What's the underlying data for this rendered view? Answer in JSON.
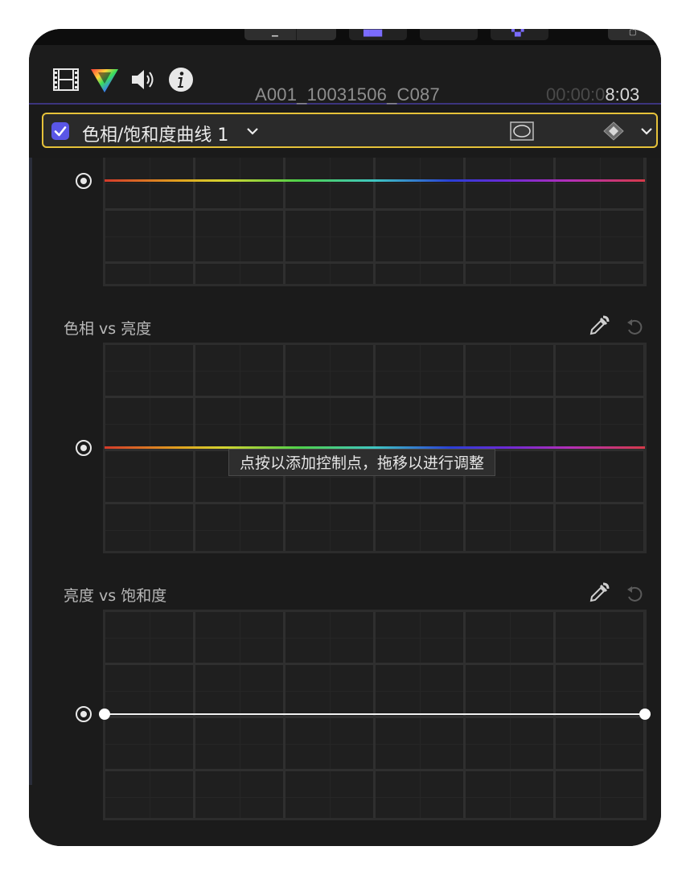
{
  "header": {
    "clip_title": "A001_10031506_C087",
    "timecode_dim": "00:00:0",
    "timecode_bright": "8:03",
    "icons": [
      "film-icon",
      "color-inspector-icon",
      "audio-icon",
      "info-icon"
    ]
  },
  "effect": {
    "enabled": true,
    "name": "色相/饱和度曲线 1",
    "accent_color": "#5a56e6",
    "selection_color": "#e6c23a"
  },
  "sections": [
    {
      "label": ""
    },
    {
      "label": "色相 vs 亮度"
    },
    {
      "label": "亮度 vs 饱和度"
    }
  ],
  "tooltip": "点按以添加控制点，拖移以进行调整"
}
